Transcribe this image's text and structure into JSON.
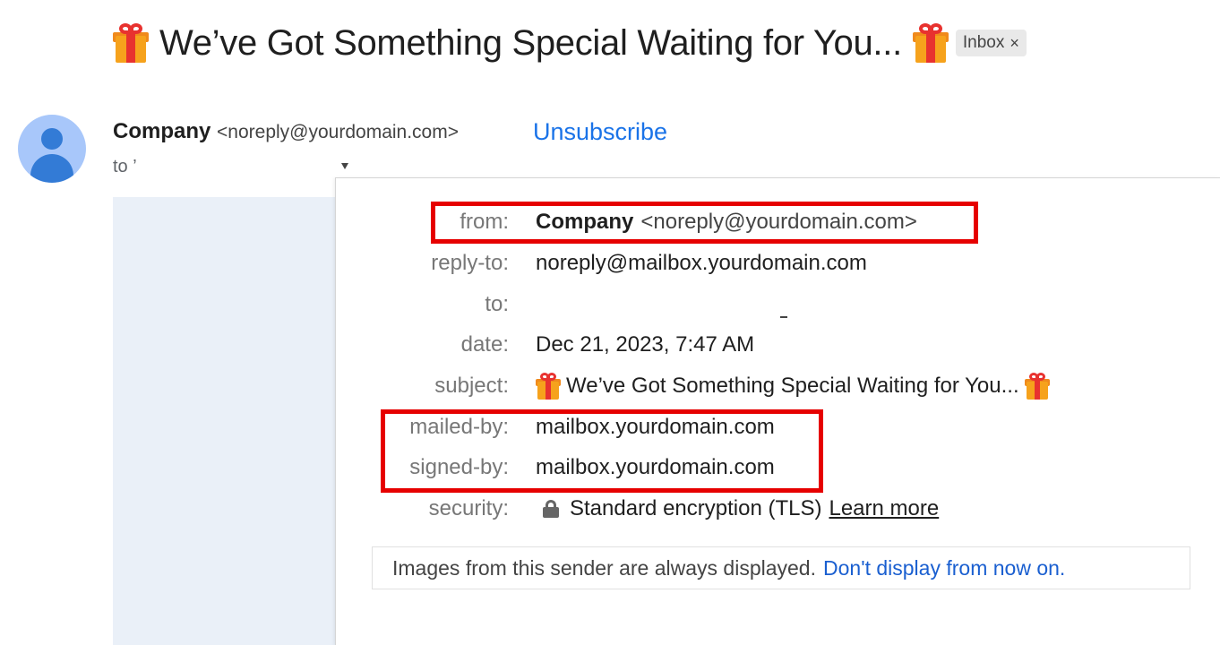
{
  "header": {
    "subject": "We’ve Got Something Special Waiting for You...",
    "label_chip": "Inbox",
    "label_chip_close": "×",
    "subject_icon": "gift-emoji"
  },
  "sender": {
    "name": "Company",
    "address": "<noreply@yourdomain.com>",
    "unsubscribe": "Unsubscribe",
    "to_prefix": "to",
    "to_value": "’"
  },
  "details": {
    "from_label": "from:",
    "from_name": "Company",
    "from_address": "<noreply@yourdomain.com>",
    "reply_to_label": "reply-to:",
    "reply_to_value": "noreply@mailbox.yourdomain.com",
    "to_label": "to:",
    "date_label": "date:",
    "date_value": "Dec 21, 2023, 7:47 AM",
    "subject_label": "subject:",
    "subject_value": "We’ve Got Something Special Waiting for You...",
    "mailed_by_label": "mailed-by:",
    "mailed_by_value": "mailbox.yourdomain.com",
    "signed_by_label": "signed-by:",
    "signed_by_value": "mailbox.yourdomain.com",
    "security_label": "security:",
    "security_value": "Standard encryption (TLS)",
    "learn_more": "Learn more",
    "security_icon": "lock-icon"
  },
  "images_notice": {
    "text": "Images from this sender are always displayed.",
    "link": "Don't display from now on."
  },
  "colors": {
    "link_blue": "#1a73e8",
    "highlight_red": "#e60000",
    "avatar_bg": "#a8c7fa"
  }
}
